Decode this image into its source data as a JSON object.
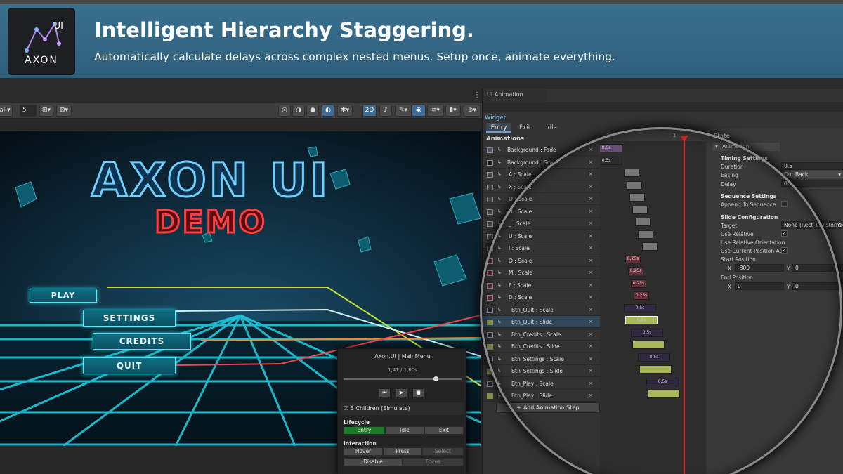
{
  "banner": {
    "title": "Intelligent Hierarchy Staggering.",
    "subtitle": "Automatically calculate delays across complex nested menus. Setup once, animate everything.",
    "logo_text": "AXON",
    "logo_sup": "UI"
  },
  "scene": {
    "toolbar_left_label": "al",
    "grid_value": "5",
    "mode_2d": "2D",
    "game_title": "AXON UI",
    "game_subtitle": "DEMO",
    "menu": [
      "PLAY",
      "SETTINGS",
      "CREDITS",
      "QUIT"
    ],
    "colors": {
      "neon_title": "#4fb8f0",
      "neon_demo": "#ff3b3b",
      "grid": "#22e0f0"
    }
  },
  "preview": {
    "title": "Axon.UI | MainMenu",
    "time": "1,41 / 1,80s",
    "progress": 0.78,
    "simulate_label": "3 Children (Simulate)",
    "simulate_checked": true,
    "lifecycle_label": "Lifecycle",
    "lifecycle": [
      "Entry",
      "Idle",
      "Exit"
    ],
    "interaction_label": "Interaction",
    "interaction_row1": [
      "Hover",
      "Press",
      "Select"
    ],
    "interaction_row2": [
      "Disable",
      "Focus"
    ]
  },
  "designer": {
    "tab_title": "UI Animation Designer",
    "widget_label": "Widget",
    "tabs": [
      "Entry",
      "Exit",
      "Idle"
    ],
    "animations_label": "Animations",
    "add_step_label": "+ Add Animation Step",
    "ruler": [
      "0",
      "1"
    ],
    "rows": [
      {
        "name": "Background : Fade",
        "bar_label": "0,5s"
      },
      {
        "name": "Background : Scale",
        "bar_label": "0,5s"
      },
      {
        "name": "A : Scale",
        "bar_label": ""
      },
      {
        "name": "X : Scale",
        "bar_label": ""
      },
      {
        "name": "O : Scale",
        "bar_label": ""
      },
      {
        "name": "N : Scale",
        "bar_label": ""
      },
      {
        "name": "_ : Scale",
        "bar_label": ""
      },
      {
        "name": "U : Scale",
        "bar_label": ""
      },
      {
        "name": "I : Scale",
        "bar_label": ""
      },
      {
        "name": "O : Scale",
        "bar_label": "0,25s"
      },
      {
        "name": "M : Scale",
        "bar_label": "0,25s"
      },
      {
        "name": "E : Scale",
        "bar_label": "0,25s"
      },
      {
        "name": "D : Scale",
        "bar_label": "0,25s"
      },
      {
        "name": "Btn_Quit : Scale",
        "bar_label": "0,5s"
      },
      {
        "name": "Btn_Quit : Slide",
        "bar_label": "0,5s"
      },
      {
        "name": "Btn_Credits : Scale",
        "bar_label": "0,5s"
      },
      {
        "name": "Btn_Credits : Slide",
        "bar_label": ""
      },
      {
        "name": "Btn_Settings : Scale",
        "bar_label": "0,5s"
      },
      {
        "name": "Btn_Settings : Slide",
        "bar_label": ""
      },
      {
        "name": "Btn_Play : Scale",
        "bar_label": "0,5s"
      },
      {
        "name": "Btn_Play : Slide",
        "bar_label": ""
      }
    ],
    "inspector": {
      "state_label": "State",
      "animation_label": "Animation",
      "timing_label": "Timing Settings",
      "duration_label": "Duration",
      "duration_value": "0.5",
      "easing_label": "Easing",
      "easing_value": "Out Back",
      "delay_label": "Delay",
      "delay_value": "0",
      "sequence_label": "Sequence Settings",
      "append_label": "Append To Sequence",
      "slide_label": "Slide Configuration",
      "target_label": "Target",
      "target_value": "None (Rect Transform)",
      "use_relative_label": "Use Relative",
      "use_rel_orient_label": "Use Relative Orientation",
      "use_current_label": "Use Current Position As",
      "start_label": "Start Position",
      "start_x": "-800",
      "start_y": "0",
      "end_label": "End Position",
      "end_x": "0",
      "end_y": "0",
      "x_axis": "X",
      "y_axis": "Y"
    }
  }
}
